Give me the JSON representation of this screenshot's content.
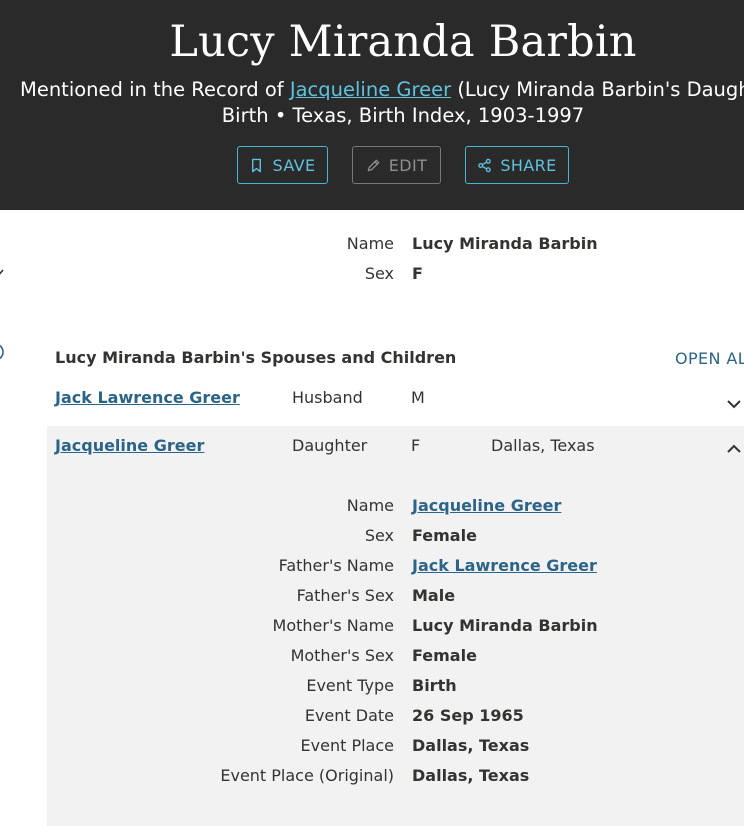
{
  "header": {
    "title": "Lucy Miranda Barbin",
    "mentioned_prefix": "Mentioned in the Record of ",
    "mentioned_link": "Jacqueline Greer",
    "mentioned_suffix": " (Lucy Miranda Barbin's Daughter)",
    "record_line": "Birth • Texas, Birth Index, 1903-1997",
    "buttons": {
      "save": "SAVE",
      "edit": "EDIT",
      "share": "SHARE"
    }
  },
  "person_fields": [
    {
      "label": "Name",
      "value": "Lucy Miranda Barbin"
    },
    {
      "label": "Sex",
      "value": "F"
    }
  ],
  "spouses_section": {
    "title": "Lucy Miranda Barbin's Spouses and Children",
    "open_all": "OPEN ALL",
    "rows": [
      {
        "name": "Jack Lawrence Greer",
        "relation": "Husband",
        "sex": "M",
        "place": ""
      },
      {
        "name": "Jacqueline Greer",
        "relation": "Daughter",
        "sex": "F",
        "place": "Dallas, Texas"
      }
    ]
  },
  "child_details": [
    {
      "label": "Name",
      "value": "Jacqueline Greer",
      "link": true
    },
    {
      "label": "Sex",
      "value": "Female",
      "link": false
    },
    {
      "label": "Father's Name",
      "value": "Jack Lawrence Greer",
      "link": true
    },
    {
      "label": "Father's Sex",
      "value": "Male",
      "link": false
    },
    {
      "label": "Mother's Name",
      "value": "Lucy Miranda Barbin",
      "link": false
    },
    {
      "label": "Mother's Sex",
      "value": "Female",
      "link": false
    },
    {
      "label": "Event Type",
      "value": "Birth",
      "link": false
    },
    {
      "label": "Event Date",
      "value": "26 Sep 1965",
      "link": false
    },
    {
      "label": "Event Place",
      "value": "Dallas, Texas",
      "link": false
    },
    {
      "label": "Event Place (Original)",
      "value": "Dallas, Texas",
      "link": false
    }
  ],
  "colors": {
    "header_bg": "#2a2a2a",
    "accent": "#5fc3df",
    "link": "#2b6488",
    "expanded_bg": "#f2f2f2"
  }
}
